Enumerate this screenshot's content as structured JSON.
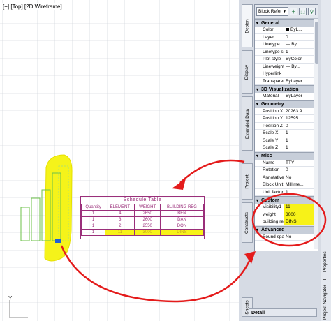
{
  "viewport": {
    "label": "[+] [Top] [2D Wireframe]",
    "axis_y": "Y"
  },
  "schedule": {
    "title": "Schedule Table",
    "headers": [
      "Quantity",
      "ELEMENT",
      "WEIGHT",
      "BUILDING REG"
    ],
    "rows": [
      [
        "1",
        "4",
        "2650",
        "BEN"
      ],
      [
        "1",
        "3",
        "2600",
        "DAN"
      ],
      [
        "1",
        "2",
        "2550",
        "DON"
      ],
      [
        "1",
        "11",
        "3000",
        "DINS"
      ]
    ]
  },
  "palette": {
    "object_type": "Block Refer",
    "tabs_left": [
      "Design",
      "Display",
      "Extended Data",
      "Project",
      "Constructs",
      "Sheets"
    ],
    "sections": {
      "general": {
        "title": "General",
        "rows": [
          {
            "k": "Color",
            "v": "ByL..."
          },
          {
            "k": "Layer",
            "v": "0"
          },
          {
            "k": "Linetype",
            "v": "— By..."
          },
          {
            "k": "Linetype sc...",
            "v": "1"
          },
          {
            "k": "Plot style",
            "v": "ByColor"
          },
          {
            "k": "Lineweight",
            "v": "— By..."
          },
          {
            "k": "Hyperlink",
            "v": ""
          },
          {
            "k": "Transparency",
            "v": "ByLayer"
          }
        ]
      },
      "viz": {
        "title": "3D Visualization",
        "rows": [
          {
            "k": "Material",
            "v": "ByLayer"
          }
        ]
      },
      "geometry": {
        "title": "Geometry",
        "rows": [
          {
            "k": "Position X",
            "v": "20263.9"
          },
          {
            "k": "Position Y",
            "v": "12595"
          },
          {
            "k": "Position Z",
            "v": "0"
          },
          {
            "k": "Scale X",
            "v": "1"
          },
          {
            "k": "Scale Y",
            "v": "1"
          },
          {
            "k": "Scale Z",
            "v": "1"
          }
        ]
      },
      "misc": {
        "title": "Misc",
        "rows": [
          {
            "k": "Name",
            "v": "TTY"
          },
          {
            "k": "Rotation",
            "v": "0"
          },
          {
            "k": "Annotative",
            "v": "No"
          },
          {
            "k": "Block Unit",
            "v": "Millime..."
          },
          {
            "k": "Unit factor",
            "v": "1"
          }
        ]
      },
      "custom": {
        "title": "Custom",
        "rows": [
          {
            "k": "Visibility1",
            "v": "11"
          },
          {
            "k": "weight",
            "v": "3000"
          },
          {
            "k": "building reg",
            "v": "DINS"
          }
        ]
      },
      "advanced": {
        "title": "Advanced",
        "rows": [
          {
            "k": "Sound spac...",
            "v": "No"
          }
        ]
      }
    },
    "detail_label": "Detail",
    "right_labels": [
      "Properties",
      "Project Navigator - T"
    ]
  }
}
